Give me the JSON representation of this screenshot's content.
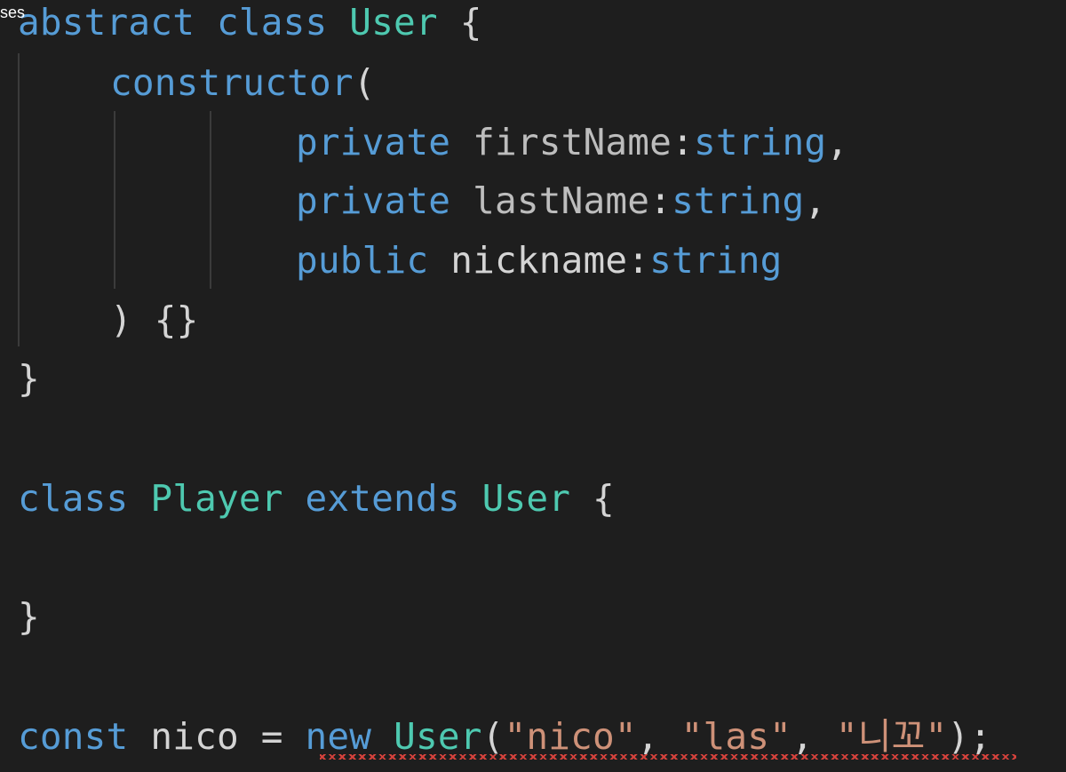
{
  "corner_label": "ses",
  "code": {
    "line1": {
      "t1": "abstract",
      "t2": "class",
      "t3": "User",
      "t4": "{"
    },
    "line2": {
      "t1": "constructor",
      "t2": "("
    },
    "line3": {
      "t1": "private",
      "t2": "firstName",
      "t3": ":",
      "t4": "string",
      "t5": ","
    },
    "line4": {
      "t1": "private",
      "t2": "lastName",
      "t3": ":",
      "t4": "string",
      "t5": ","
    },
    "line5": {
      "t1": "public",
      "t2": "nickname",
      "t3": ":",
      "t4": "string"
    },
    "line6": {
      "t1": ")",
      "t2": "{}"
    },
    "line7": {
      "t1": "}"
    },
    "line8": {
      "t1": "class",
      "t2": "Player",
      "t3": "extends",
      "t4": "User",
      "t5": "{"
    },
    "line9": {
      "t1": "}"
    },
    "line10": {
      "t1": "const",
      "t2": "nico",
      "t3": "=",
      "t4": "new",
      "t5": "User",
      "t6": "(",
      "t7": "\"nico\"",
      "t8": ",",
      "t9": "\"las\"",
      "t10": ",",
      "t11": "\"니꼬\"",
      "t12": ");"
    }
  },
  "colors": {
    "background": "#1e1e1e",
    "keyword": "#569cd6",
    "type": "#4ec9b0",
    "string": "#ce9178",
    "error": "#e0443e"
  }
}
